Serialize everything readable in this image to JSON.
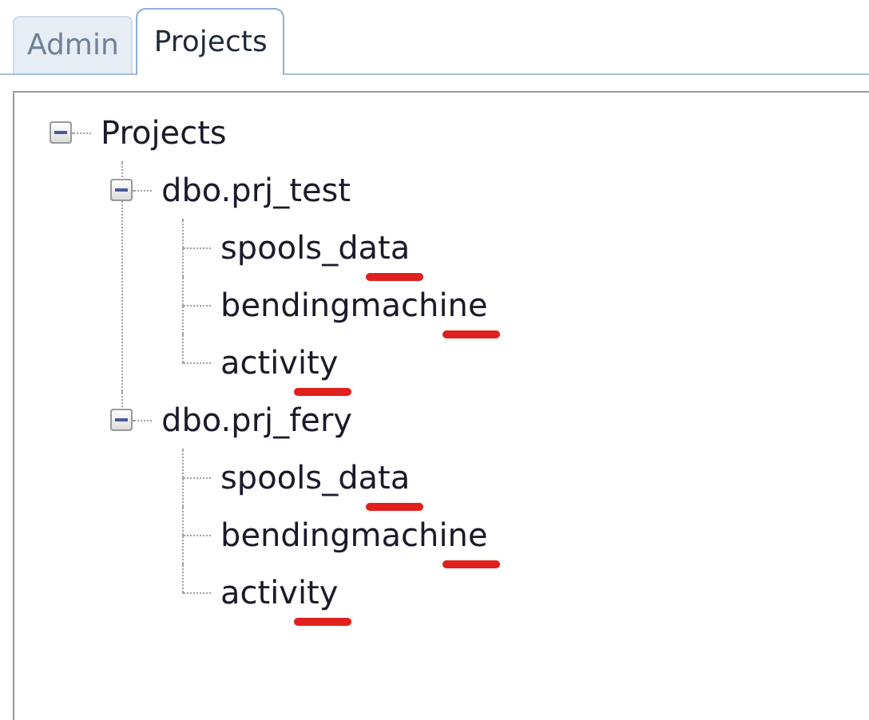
{
  "tabs": [
    {
      "label": "Admin",
      "selected": false
    },
    {
      "label": "Projects",
      "selected": true
    }
  ],
  "tree": [
    {
      "label": "Projects",
      "expanded": true,
      "children": [
        {
          "label": "dbo.prj_test",
          "expanded": true,
          "children": [
            {
              "label": "spools_data",
              "marked": true
            },
            {
              "label": "bendingmachine",
              "marked": true
            },
            {
              "label": "activity",
              "marked": true
            }
          ]
        },
        {
          "label": "dbo.prj_fery",
          "expanded": true,
          "children": [
            {
              "label": "spools_data",
              "marked": true
            },
            {
              "label": "bendingmachine",
              "marked": true
            },
            {
              "label": "activity",
              "marked": true
            }
          ]
        }
      ]
    }
  ]
}
